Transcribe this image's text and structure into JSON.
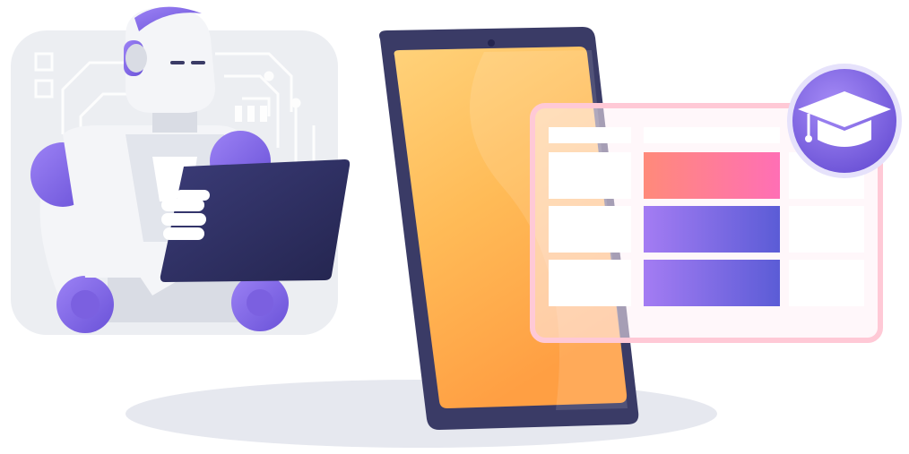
{
  "colors": {
    "background": "#ffffff",
    "ground_shadow": "#e4e6ee",
    "circuit_panel": "#eceef2",
    "circuit_lines": "#ffffff",
    "robot_purple": "#8a6ef0",
    "robot_purple_dark": "#6a52d8",
    "robot_white": "#f4f5f8",
    "robot_shade": "#d9dce4",
    "tablet_small": "#2e2f63",
    "phone_frame": "#3a3b66",
    "phone_screen_top": "#ffcf6e",
    "phone_screen_bottom": "#ff9f43",
    "panel_border": "#ffc9d6",
    "panel_fill": "#fff1f5",
    "bar_pink_start": "#ff7e7e",
    "bar_pink_end": "#ff6fb5",
    "bar_violet_start": "#a47cf3",
    "bar_violet_end": "#5b5cd6",
    "badge": "#8a6ef0"
  },
  "icons": {
    "badge": "graduation-cap-icon"
  },
  "table_rows": [
    {
      "bar": "pink"
    },
    {
      "bar": "violet"
    },
    {
      "bar": "violet"
    }
  ]
}
